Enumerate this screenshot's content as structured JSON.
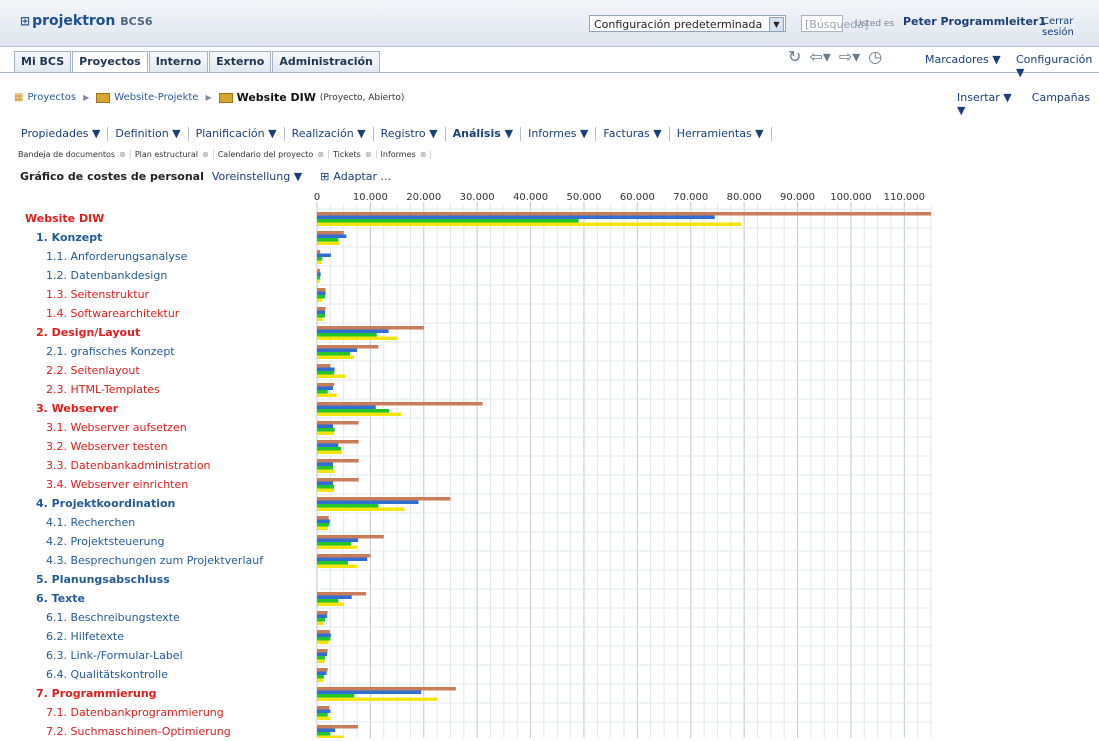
{
  "header": {
    "logo_text": "projektron",
    "logo_suffix": "BCS6",
    "config_select": "Configuración predeterminada",
    "search_placeholder": "[Búsqueda]",
    "user_label": "Usted es",
    "user_name": "Peter Programmleiter1",
    "logout": "Cerrar sesión"
  },
  "main_tabs": [
    "Mi BCS",
    "Proyectos",
    "Interno",
    "Externo",
    "Administración"
  ],
  "toolbar": {
    "bookmarks": "Marcadores ▼",
    "configuration": "Configuración ▼"
  },
  "breadcrumb": {
    "items": [
      "Proyectos",
      "Website-Projekte"
    ],
    "current": "Website DIW",
    "current_meta": "(Proyecto, Abierto)"
  },
  "actions": {
    "insert": "Insertar ▼",
    "campaigns": "Campañas ▼"
  },
  "menu": [
    "Propiedades ▼",
    "Definition ▼",
    "Planificación ▼",
    "Realización ▼",
    "Registro ▼",
    "Análisis ▼",
    "Informes ▼",
    "Facturas ▼",
    "Herramientas ▼"
  ],
  "doc_tabs": [
    "Bandeja de documentos",
    "Plan estructural",
    "Calendario del proyecto",
    "Tickets",
    "Informes"
  ],
  "chart_header": {
    "title": "Gráfico de costes de personal",
    "preset": "Voreinstellung ▼",
    "adapt": "Adaptar ..."
  },
  "tree": [
    {
      "label": "Website DIW",
      "level": 0,
      "color": "red"
    },
    {
      "label": "1. Konzept",
      "level": 1,
      "color": "blue"
    },
    {
      "label": "1.1.  Anforderungsanalyse",
      "level": 2,
      "color": "blue"
    },
    {
      "label": "1.2.  Datenbankdesign",
      "level": 2,
      "color": "blue"
    },
    {
      "label": "1.3.  Seitenstruktur",
      "level": 2,
      "color": "red"
    },
    {
      "label": "1.4.  Softwarearchitektur",
      "level": 2,
      "color": "red"
    },
    {
      "label": "2. Design/Layout",
      "level": 1,
      "color": "red"
    },
    {
      "label": "2.1.  grafisches Konzept",
      "level": 2,
      "color": "blue"
    },
    {
      "label": "2.2.  Seitenlayout",
      "level": 2,
      "color": "red"
    },
    {
      "label": "2.3.  HTML-Templates",
      "level": 2,
      "color": "red"
    },
    {
      "label": "3. Webserver",
      "level": 1,
      "color": "red"
    },
    {
      "label": "3.1.  Webserver aufsetzen",
      "level": 2,
      "color": "red"
    },
    {
      "label": "3.2.  Webserver testen",
      "level": 2,
      "color": "red"
    },
    {
      "label": "3.3.  Datenbankadministration",
      "level": 2,
      "color": "red"
    },
    {
      "label": "3.4.  Webserver einrichten",
      "level": 2,
      "color": "red"
    },
    {
      "label": "4. Projektkoordination",
      "level": 1,
      "color": "blue"
    },
    {
      "label": "4.1.  Recherchen",
      "level": 2,
      "color": "blue"
    },
    {
      "label": "4.2.  Projektsteuerung",
      "level": 2,
      "color": "blue"
    },
    {
      "label": "4.3.  Besprechungen zum Projektverlauf",
      "level": 2,
      "color": "blue"
    },
    {
      "label": "5. Planungsabschluss",
      "level": 1,
      "color": "plain"
    },
    {
      "label": "6. Texte",
      "level": 1,
      "color": "blue"
    },
    {
      "label": "6.1.  Beschreibungstexte",
      "level": 2,
      "color": "blue"
    },
    {
      "label": "6.2.  Hilfetexte",
      "level": 2,
      "color": "blue"
    },
    {
      "label": "6.3.  Link-/Formular-Label",
      "level": 2,
      "color": "blue"
    },
    {
      "label": "6.4.  Qualitätskontrolle",
      "level": 2,
      "color": "blue"
    },
    {
      "label": "7. Programmierung",
      "level": 1,
      "color": "red"
    },
    {
      "label": "7.1.  Datenbankprogrammierung",
      "level": 2,
      "color": "red"
    },
    {
      "label": "7.2.  Suchmaschinen-Optimierung",
      "level": 2,
      "color": "red"
    }
  ],
  "chart_data": {
    "type": "bar",
    "title": "",
    "xlabel": "",
    "ylabel": "",
    "xlim": [
      0,
      115000
    ],
    "ticks": [
      0,
      10000,
      20000,
      30000,
      40000,
      50000,
      60000,
      70000,
      80000,
      90000,
      100000,
      110000
    ],
    "tick_labels": [
      "0",
      "10.000",
      "20.000",
      "30.000",
      "40.000",
      "50.000",
      "60.000",
      "70.000",
      "80.000",
      "90.000",
      "100.000",
      "110.000"
    ],
    "categories": [
      "Website DIW",
      "1. Konzept",
      "1.1. Anforderungsanalyse",
      "1.2. Datenbankdesign",
      "1.3. Seitenstruktur",
      "1.4. Softwarearchitektur",
      "2. Design/Layout",
      "2.1. grafisches Konzept",
      "2.2. Seitenlayout",
      "2.3. HTML-Templates",
      "3. Webserver",
      "3.1. Webserver aufsetzen",
      "3.2. Webserver testen",
      "3.3. Datenbankadministration",
      "3.4. Webserver einrichten",
      "4. Projektkoordination",
      "4.1. Recherchen",
      "4.2. Projektsteuerung",
      "4.3. Besprechungen zum Projektverlauf",
      "5. Planungsabschluss",
      "6. Texte",
      "6.1. Beschreibungstexte",
      "6.2. Hilfetexte",
      "6.3. Link-/Formular-Label",
      "6.4. Qualitätskontrolle",
      "7. Programmierung",
      "7.1. Datenbankprogrammierung",
      "7.2. Suchmaschinen-Optimierung"
    ],
    "series": [
      {
        "color": "#c87c5a",
        "values": [
          115000,
          5000,
          600,
          600,
          1600,
          1600,
          20000,
          11500,
          2500,
          3200,
          31000,
          7800,
          7800,
          7800,
          7800,
          25000,
          2200,
          12500,
          10000,
          0,
          9200,
          2000,
          2400,
          2000,
          2000,
          26000,
          2300,
          7700
        ]
      },
      {
        "color": "#2f6fd3",
        "values": [
          74500,
          5500,
          2600,
          700,
          1600,
          1500,
          13400,
          7500,
          3300,
          3000,
          11000,
          3000,
          4000,
          3000,
          3000,
          19000,
          2400,
          7700,
          9400,
          0,
          6500,
          1900,
          2600,
          1900,
          1800,
          19500,
          2500,
          3400
        ]
      },
      {
        "color": "#22c52c",
        "values": [
          49000,
          4000,
          1000,
          600,
          1500,
          1500,
          11200,
          6200,
          3200,
          2000,
          13500,
          3300,
          4500,
          3000,
          3200,
          11500,
          2300,
          6400,
          5800,
          0,
          4000,
          1500,
          2500,
          1500,
          1300,
          7000,
          2000,
          2500
        ]
      },
      {
        "color": "#f2e40c",
        "values": [
          79500,
          4200,
          800,
          500,
          1000,
          1100,
          15000,
          6900,
          5300,
          3700,
          15800,
          3200,
          4700,
          3300,
          3200,
          16400,
          2000,
          7500,
          7500,
          0,
          5000,
          1200,
          2200,
          1400,
          1200,
          22500,
          2500,
          4900
        ]
      }
    ]
  }
}
